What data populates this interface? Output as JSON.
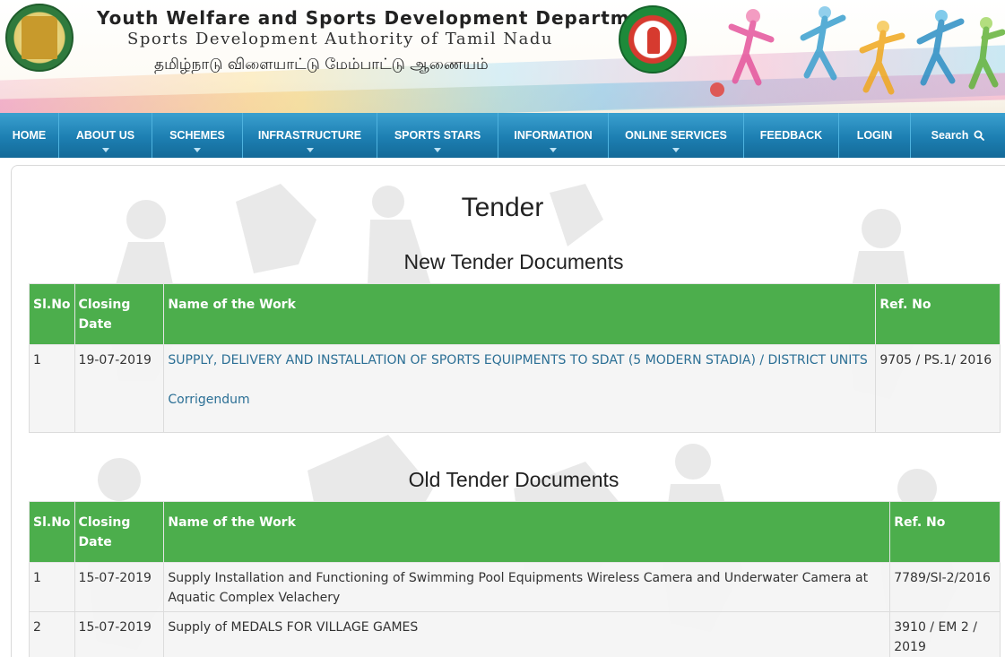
{
  "header": {
    "title_en": "Youth Welfare and Sports Development Department",
    "subtitle_en": "Sports Development Authority of Tamil Nadu",
    "title_ta": "தமிழ்நாடு விளையாட்டு மேம்பாட்டு ஆணையம்",
    "emblem_icon": "tamil-nadu-emblem-icon",
    "sdat_logo_icon": "sdat-logo-icon"
  },
  "nav": {
    "items": [
      {
        "label": "HOME",
        "caret": false
      },
      {
        "label": "ABOUT US",
        "caret": true
      },
      {
        "label": "SCHEMES",
        "caret": true
      },
      {
        "label": "INFRASTRUCTURE",
        "caret": true
      },
      {
        "label": "SPORTS STARS",
        "caret": true
      },
      {
        "label": "INFORMATION",
        "caret": true
      },
      {
        "label": "ONLINE SERVICES",
        "caret": true
      },
      {
        "label": "FEEDBACK",
        "caret": false
      },
      {
        "label": "LOGIN",
        "caret": false
      }
    ],
    "search_label": "Search"
  },
  "page": {
    "title": "Tender",
    "new_section_title": "New Tender Documents",
    "old_section_title": "Old Tender Documents"
  },
  "table_headers": {
    "sl_no": "Sl.No",
    "closing_date": "Closing Date",
    "name_of_work": "Name of the Work",
    "ref_no": "Ref. No"
  },
  "new_tenders": [
    {
      "sl_no": "1",
      "closing_date": "19-07-2019",
      "name": "SUPPLY, DELIVERY AND INSTALLATION OF SPORTS EQUIPMENTS TO SDAT (5 MODERN STADIA) / DISTRICT UNITS",
      "corrigendum": "Corrigendum",
      "ref_no": "9705 / PS.1/ 2016"
    }
  ],
  "old_tenders": [
    {
      "sl_no": "1",
      "closing_date": "15-07-2019",
      "name": "Supply Installation and Functioning of Swimming Pool Equipments Wireless Camera and Underwater Camera at Aquatic Complex Velachery",
      "ref_no": "7789/SI-2/2016"
    },
    {
      "sl_no": "2",
      "closing_date": "15-07-2019",
      "name": "Supply of MEDALS FOR VILLAGE GAMES",
      "ref_no": "3910 / EM 2 / 2019"
    }
  ],
  "colors": {
    "nav_blue": "#1d7fb2",
    "table_header_green": "#4cae4c",
    "link_blue": "#2b6f95"
  }
}
